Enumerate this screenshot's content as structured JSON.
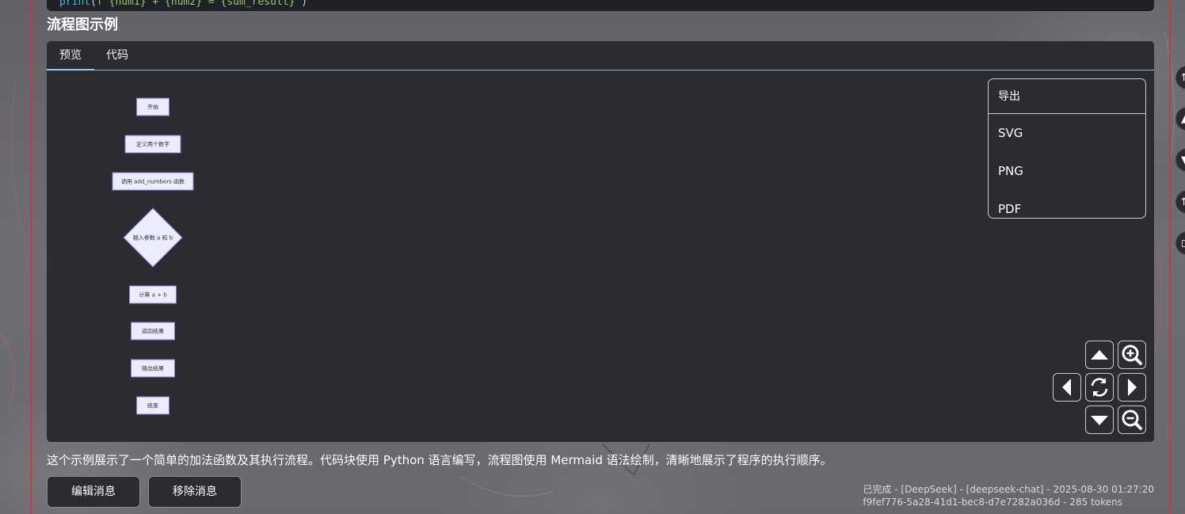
{
  "code_fragment": {
    "parts": [
      "print",
      "(",
      "f\"{num1} + {num2} = {sum_result}\"",
      ")"
    ]
  },
  "section_title": "流程图示例",
  "tabs": [
    {
      "label": "预览",
      "active": true
    },
    {
      "label": "代码",
      "active": false
    }
  ],
  "flowchart": {
    "nodes": [
      {
        "label": "开始",
        "shape": "rect"
      },
      {
        "label": "定义两个数字",
        "shape": "rect"
      },
      {
        "label": "调用 add_numbers 函数",
        "shape": "rect"
      },
      {
        "label": "输入参数 a 和 b",
        "shape": "diamond"
      },
      {
        "label": "计算 a + b",
        "shape": "rect"
      },
      {
        "label": "返回结果",
        "shape": "rect"
      },
      {
        "label": "输出结果",
        "shape": "rect"
      },
      {
        "label": "结束",
        "shape": "rect"
      }
    ],
    "node_fill": "#ececff",
    "node_stroke": "#9370db"
  },
  "export_menu": {
    "header": "导出",
    "items": [
      "SVG",
      "PNG",
      "PDF"
    ]
  },
  "controls": {
    "pan_up": "triangle-up-icon",
    "zoom_in": "zoom-in-icon",
    "pan_left": "triangle-left-icon",
    "reset": "refresh-icon",
    "pan_right": "triangle-right-icon",
    "pan_down": "triangle-down-icon",
    "zoom_out": "zoom-out-icon"
  },
  "description": "这个示例展示了一个简单的加法函数及其执行流程。代码块使用 Python 语言编写，流程图使用 Mermaid 语法绘制，清晰地展示了程序的执行顺序。",
  "actions": {
    "edit_label": "编辑消息",
    "remove_label": "移除消息"
  },
  "meta": {
    "line1": "已完成 - [DeepSeek] - [deepseek-chat] - 2025-08-30 01:27:20",
    "line2": "f9fef776-5a28-41d1-bec8-d7e7282a036d - 285 tokens"
  },
  "colors": {
    "panel_bg": "#2b2c31",
    "column_border": "#b8413f",
    "tab_underline": "#9fc8e6"
  }
}
